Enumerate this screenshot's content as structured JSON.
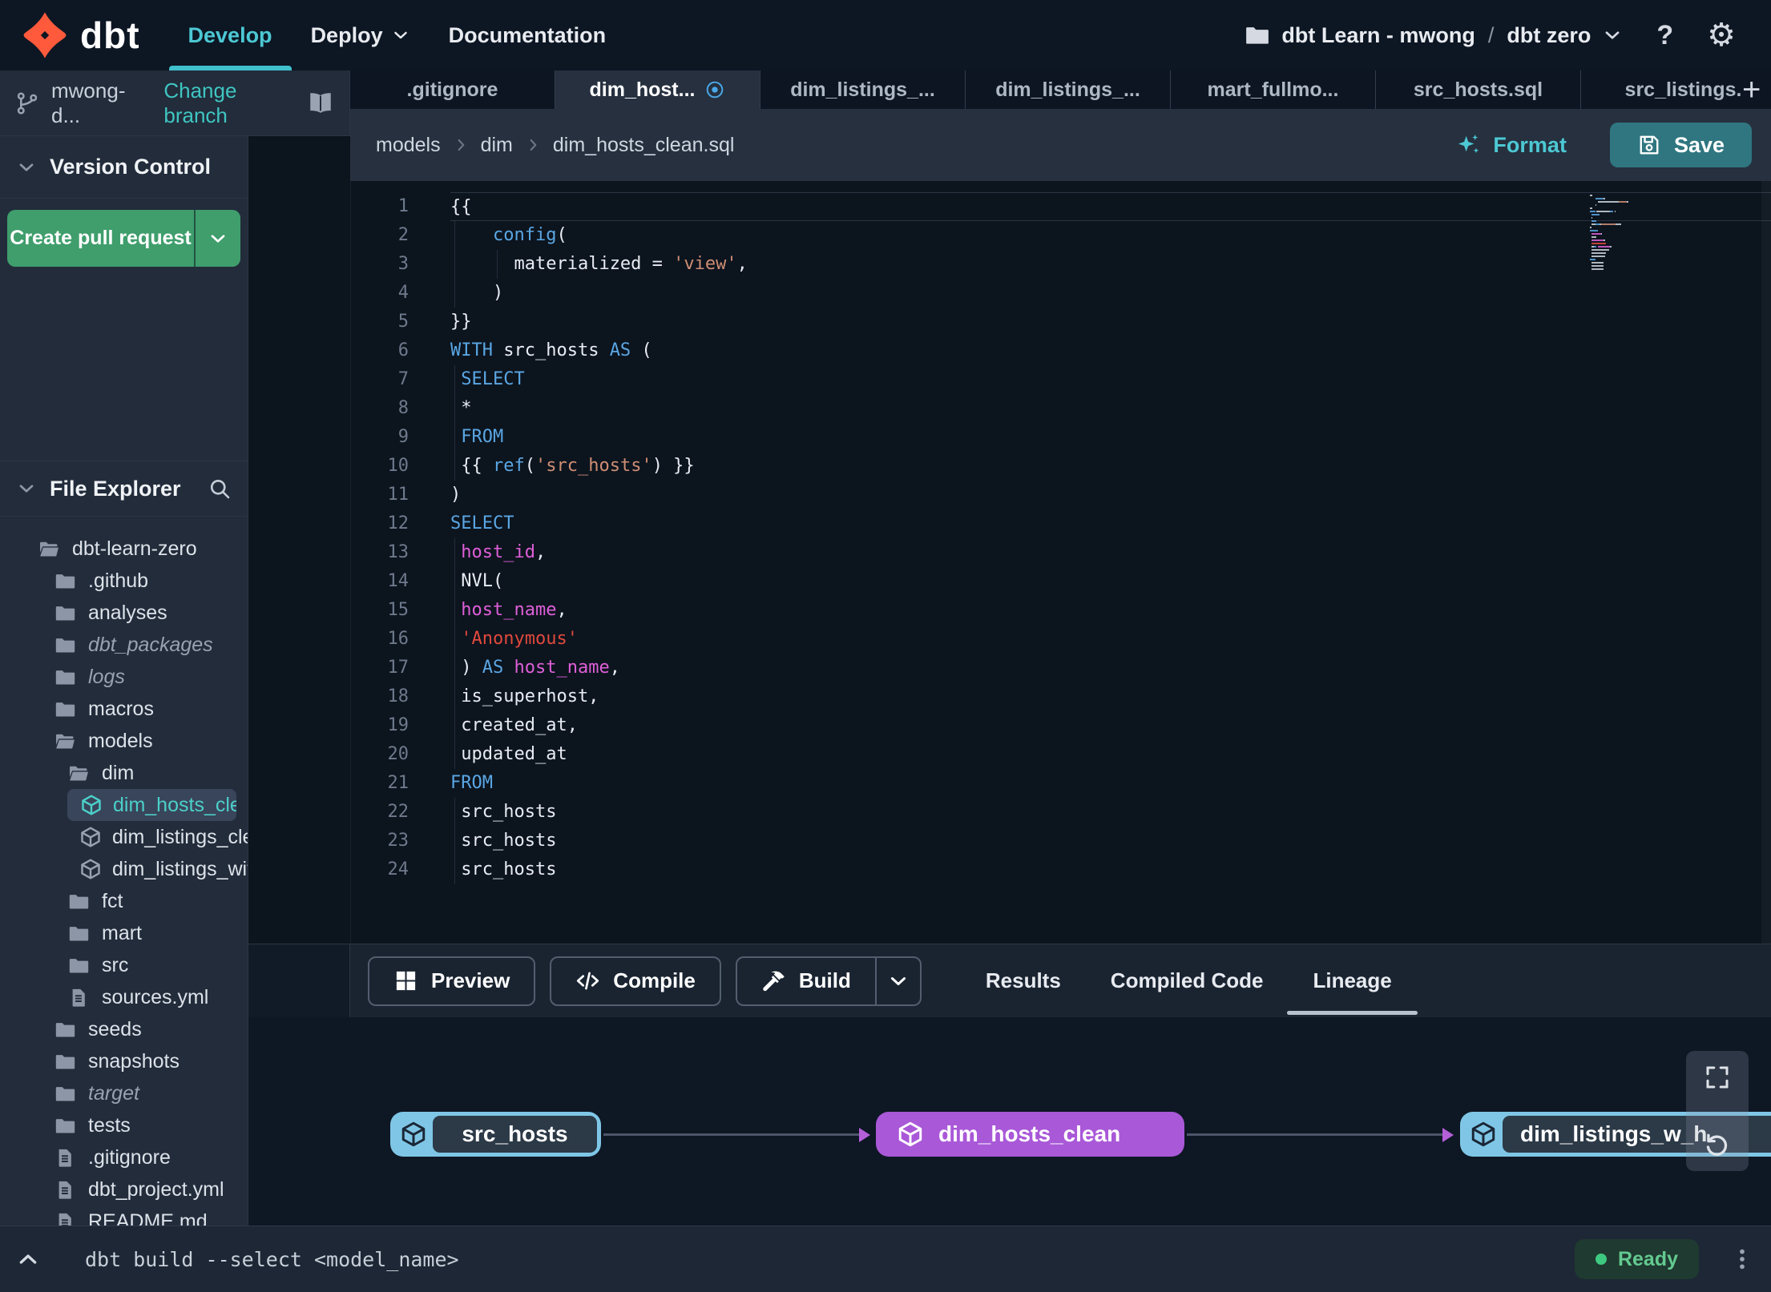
{
  "navbar": {
    "brand": "dbt",
    "items": [
      {
        "label": "Develop",
        "active": true
      },
      {
        "label": "Deploy",
        "chevron": true
      },
      {
        "label": "Documentation"
      }
    ],
    "project": {
      "name": "dbt Learn - mwong",
      "separator": "/",
      "env": "dbt zero"
    },
    "help_glyph": "?",
    "settings_glyph": "⚙"
  },
  "branch_bar": {
    "branch": "mwong-d...",
    "change_branch": "Change branch"
  },
  "version_control": {
    "title": "Version Control",
    "create_pr_label": "Create pull request"
  },
  "file_explorer": {
    "title": "File Explorer",
    "modified_glyph": "•",
    "tree": [
      {
        "label": "dbt-learn-zero",
        "icon": "folder-open",
        "level": 0
      },
      {
        "label": ".github",
        "icon": "folder",
        "level": 1
      },
      {
        "label": "analyses",
        "icon": "folder",
        "level": 1
      },
      {
        "label": "dbt_packages",
        "icon": "folder",
        "level": 1,
        "italic": true
      },
      {
        "label": "logs",
        "icon": "folder",
        "level": 1,
        "italic": true
      },
      {
        "label": "macros",
        "icon": "folder",
        "level": 1
      },
      {
        "label": "models",
        "icon": "folder-open",
        "level": 1
      },
      {
        "label": "dim",
        "icon": "folder-open",
        "level": 2
      },
      {
        "label": "dim_hosts_clean.sql",
        "icon": "model",
        "level": 3,
        "selected": true,
        "modified": true
      },
      {
        "label": "dim_listings_clean.sql",
        "icon": "model",
        "level": 3
      },
      {
        "label": "dim_listings_with_hosts...",
        "icon": "model",
        "level": 3
      },
      {
        "label": "fct",
        "icon": "folder",
        "level": 2
      },
      {
        "label": "mart",
        "icon": "folder",
        "level": 2
      },
      {
        "label": "src",
        "icon": "folder",
        "level": 2
      },
      {
        "label": "sources.yml",
        "icon": "file",
        "level": 2
      },
      {
        "label": "seeds",
        "icon": "folder",
        "level": 1
      },
      {
        "label": "snapshots",
        "icon": "folder",
        "level": 1
      },
      {
        "label": "target",
        "icon": "folder",
        "level": 1,
        "italic": true
      },
      {
        "label": "tests",
        "icon": "folder",
        "level": 1
      },
      {
        "label": ".gitignore",
        "icon": "file",
        "level": 1
      },
      {
        "label": "dbt_project.yml",
        "icon": "file",
        "level": 1
      },
      {
        "label": "README.md",
        "icon": "file",
        "level": 1
      }
    ]
  },
  "tabs": [
    {
      "label": ".gitignore"
    },
    {
      "label": "dim_host...",
      "active": true,
      "modified": true
    },
    {
      "label": "dim_listings_..."
    },
    {
      "label": "dim_listings_..."
    },
    {
      "label": "mart_fullmo..."
    },
    {
      "label": "src_hosts.sql"
    },
    {
      "label": "src_listings."
    }
  ],
  "tabs_bar": {
    "new_tab_glyph": "+"
  },
  "editor": {
    "breadcrumb": [
      "models",
      "dim",
      "dim_hosts_clean.sql"
    ],
    "format_label": "Format",
    "save_label": "Save",
    "lines": [
      {
        "n": 1,
        "current": true,
        "segs": [
          [
            "p",
            "{{"
          ]
        ]
      },
      {
        "n": 2,
        "guides": [
          0
        ],
        "segs": [
          [
            "p",
            "    "
          ],
          [
            "k",
            "config"
          ],
          [
            "p",
            "("
          ]
        ]
      },
      {
        "n": 3,
        "guides": [
          0,
          4
        ],
        "segs": [
          [
            "p",
            "      "
          ],
          [
            "p",
            "materialized = "
          ],
          [
            "s1",
            "'view'"
          ],
          [
            "p",
            ","
          ]
        ]
      },
      {
        "n": 4,
        "guides": [
          0
        ],
        "segs": [
          [
            "p",
            "    )"
          ]
        ]
      },
      {
        "n": 5,
        "segs": [
          [
            "p",
            "}}"
          ]
        ]
      },
      {
        "n": 6,
        "segs": [
          [
            "k",
            "WITH"
          ],
          [
            "p",
            " src_hosts "
          ],
          [
            "k",
            "AS"
          ],
          [
            "p",
            " ("
          ]
        ]
      },
      {
        "n": 7,
        "guides": [
          0
        ],
        "segs": [
          [
            "p",
            " "
          ],
          [
            "k",
            "SELECT"
          ]
        ]
      },
      {
        "n": 8,
        "guides": [
          0
        ],
        "segs": [
          [
            "p",
            " *"
          ]
        ]
      },
      {
        "n": 9,
        "guides": [
          0
        ],
        "segs": [
          [
            "p",
            " "
          ],
          [
            "k",
            "FROM"
          ]
        ]
      },
      {
        "n": 10,
        "guides": [
          0
        ],
        "segs": [
          [
            "p",
            " {{ "
          ],
          [
            "k",
            "ref"
          ],
          [
            "p",
            "("
          ],
          [
            "s1",
            "'src_hosts'"
          ],
          [
            "p",
            ") }}"
          ]
        ]
      },
      {
        "n": 11,
        "segs": [
          [
            "p",
            ")"
          ]
        ]
      },
      {
        "n": 12,
        "segs": [
          [
            "k",
            "SELECT"
          ]
        ]
      },
      {
        "n": 13,
        "guides": [
          0
        ],
        "segs": [
          [
            "p",
            " "
          ],
          [
            "f",
            "host_id"
          ],
          [
            "p",
            ","
          ]
        ]
      },
      {
        "n": 14,
        "guides": [
          0
        ],
        "segs": [
          [
            "p",
            " NVL("
          ]
        ]
      },
      {
        "n": 15,
        "guides": [
          0
        ],
        "segs": [
          [
            "p",
            " "
          ],
          [
            "f",
            "host_name"
          ],
          [
            "p",
            ","
          ]
        ]
      },
      {
        "n": 16,
        "guides": [
          0
        ],
        "segs": [
          [
            "p",
            " "
          ],
          [
            "s2",
            "'Anonymous'"
          ]
        ]
      },
      {
        "n": 17,
        "guides": [
          0
        ],
        "segs": [
          [
            "p",
            " ) "
          ],
          [
            "k",
            "AS"
          ],
          [
            "p",
            " "
          ],
          [
            "f",
            "host_name"
          ],
          [
            "p",
            ","
          ]
        ]
      },
      {
        "n": 18,
        "guides": [
          0
        ],
        "segs": [
          [
            "p",
            " is_superhost,"
          ]
        ]
      },
      {
        "n": 19,
        "guides": [
          0
        ],
        "segs": [
          [
            "p",
            " created_at,"
          ]
        ]
      },
      {
        "n": 20,
        "guides": [
          0
        ],
        "segs": [
          [
            "p",
            " updated_at"
          ]
        ]
      },
      {
        "n": 21,
        "segs": [
          [
            "k",
            "FROM"
          ]
        ]
      },
      {
        "n": 22,
        "guides": [
          0
        ],
        "segs": [
          [
            "p",
            " src_hosts"
          ]
        ]
      },
      {
        "n": 23,
        "guides": [
          0
        ],
        "segs": [
          [
            "p",
            " src_hosts"
          ]
        ]
      },
      {
        "n": 24,
        "guides": [
          0
        ],
        "segs": [
          [
            "p",
            " src_hosts"
          ]
        ]
      }
    ]
  },
  "bottom_panel": {
    "actions": [
      {
        "label": "Preview",
        "icon": "grid"
      },
      {
        "label": "Compile",
        "icon": "codeIcon"
      },
      {
        "label": "Build",
        "icon": "hammer",
        "split": true
      }
    ],
    "tabs": [
      {
        "label": "Results"
      },
      {
        "label": "Compiled Code"
      },
      {
        "label": "Lineage",
        "active": true
      }
    ]
  },
  "lineage": {
    "nodes": [
      {
        "label": "src_hosts",
        "type": "source"
      },
      {
        "label": "dim_hosts_clean",
        "type": "model"
      },
      {
        "label": "dim_listings_w_h",
        "type": "source"
      }
    ]
  },
  "status_bar": {
    "command": "dbt build --select <model_name>",
    "status": "Ready"
  },
  "colors": {
    "accent_teal": "#4cc8d4",
    "brand_orange": "#ff5a3c",
    "button_green": "#3f9e6c",
    "save_teal": "#2f7680",
    "node_blue": "#7fc6e6",
    "node_purple": "#a958d8",
    "ready_green": "#3ec981",
    "keyword_blue": "#5aa6e3",
    "identifier_magenta": "#de5fd8",
    "string_salmon": "#cf8e74",
    "string_red": "#e0493c"
  }
}
